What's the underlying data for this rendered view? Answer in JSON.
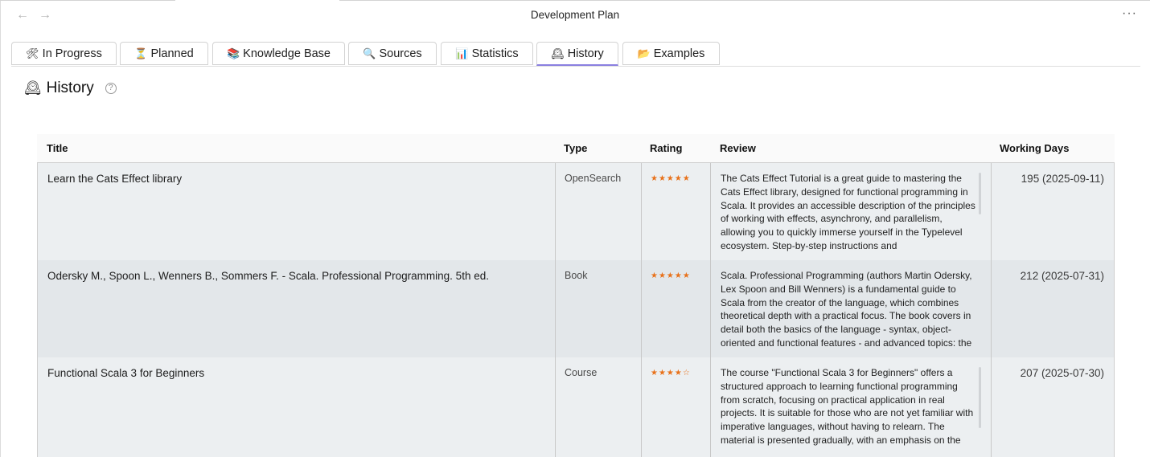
{
  "window": {
    "title": "Development Plan",
    "back_icon": "←",
    "forward_icon": "→",
    "more_icon": "···"
  },
  "tabs": [
    {
      "emoji": "🛠",
      "label": "In Progress"
    },
    {
      "emoji": "⏳",
      "label": "Planned"
    },
    {
      "emoji": "📚",
      "label": "Knowledge Base"
    },
    {
      "emoji": "🔍",
      "label": "Sources"
    },
    {
      "emoji": "📊",
      "label": "Statistics"
    },
    {
      "emoji": "🕰",
      "label": "History"
    },
    {
      "emoji": "📂",
      "label": "Examples"
    }
  ],
  "active_tab": "History",
  "page": {
    "emoji": "🕰",
    "heading": "History",
    "help_icon": "?"
  },
  "table": {
    "columns": [
      "Title",
      "Type",
      "Rating",
      "Review",
      "Working Days"
    ],
    "rows": [
      {
        "title": "Learn the Cats Effect library",
        "type": "OpenSearch",
        "rating": "★★★★★",
        "review": "The Cats Effect Tutorial is a great guide to mastering the Cats Effect library, designed for functional programming in Scala. It provides an accessible description of the principles of working with effects, asynchrony, and parallelism, allowing you to quickly immerse yourself in the Typelevel ecosystem. Step-by-step instructions and",
        "working_days": "195 (2025-09-11)"
      },
      {
        "title": "Odersky M., Spoon L., Wenners B., Sommers F. - Scala. Professional Programming. 5th ed.",
        "type": "Book",
        "rating": "★★★★★",
        "review": "Scala. Professional Programming (authors Martin Odersky, Lex Spoon and Bill Wenners) is a fundamental guide to Scala from the creator of the language, which combines theoretical depth with a practical focus. The book covers in detail both the basics of the language - syntax, object-oriented and functional features - and advanced topics: the",
        "working_days": "212 (2025-07-31)"
      },
      {
        "title": "Functional Scala 3 for Beginners",
        "type": "Course",
        "rating": "★★★★☆",
        "review": "The course \"Functional Scala 3 for Beginners\" offers a structured approach to learning functional programming from scratch, focusing on practical application in real projects. It is suitable for those who are not yet familiar with imperative languages, without having to relearn. The material is presented gradually, with an emphasis on the",
        "working_days": "207 (2025-07-30)"
      }
    ]
  }
}
